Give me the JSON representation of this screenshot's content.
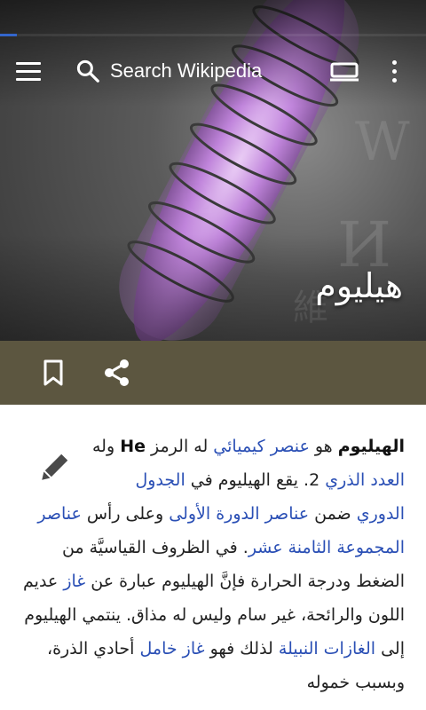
{
  "toolbar": {
    "search_placeholder": "Search Wikipedia"
  },
  "loading_progress_percent": 4,
  "article": {
    "title": "هيليوم",
    "p1": {
      "term": "الهيليوم",
      "t1": " هو ",
      "link_chemical_element": "عنصر كيميائي",
      "t2": " له الرمز ",
      "symbol": "He",
      "t3": " وله ",
      "link_atomic_number": "العدد الذري",
      "t4": " 2. يقع الهيليوم في ",
      "link_periodic_table": "الجدول الدوري",
      "t5": " ضمن ",
      "link_period1": "عناصر الدورة الأولى",
      "t6": " وعلى رأس ",
      "link_group18": "عناصر المجموعة الثامنة عشر",
      "t7": ". في الظروف القياسيَّة من الضغط ودرجة الحرارة فإنَّ الهيليوم عبارة عن ",
      "link_gas": "غاز",
      "t8": " عديم اللون والرائحة، غير سام وليس له مذاق. ينتمي الهيليوم إلى ",
      "link_noble_gases": "الغازات النبيلة",
      "t9": " لذلك فهو ",
      "link_inert_gas": "غاز خامل",
      "t10": " أحادي الذرة، وبسبب خموله"
    }
  },
  "icons": {
    "menu": "menu-icon",
    "search": "search-icon",
    "tabs": "tabs-icon",
    "overflow": "overflow-menu-icon",
    "bookmark": "bookmark-icon",
    "share": "share-icon",
    "edit": "pencil-icon"
  },
  "colors": {
    "action_bar": "#5c5640",
    "link": "#2a4fb5",
    "progress": "#36c"
  }
}
